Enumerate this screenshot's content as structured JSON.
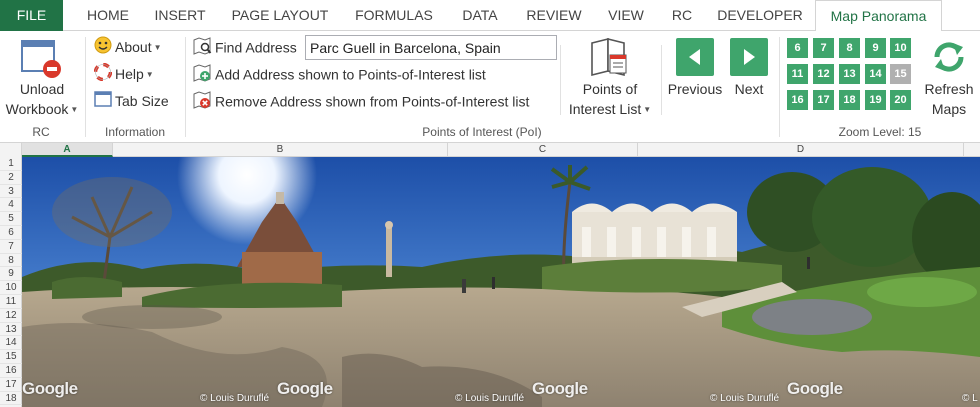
{
  "tabs": [
    {
      "label": "FILE"
    },
    {
      "label": "HOME"
    },
    {
      "label": "INSERT"
    },
    {
      "label": "PAGE LAYOUT"
    },
    {
      "label": "FORMULAS"
    },
    {
      "label": "DATA"
    },
    {
      "label": "REVIEW"
    },
    {
      "label": "VIEW"
    },
    {
      "label": "RC"
    },
    {
      "label": "DEVELOPER"
    },
    {
      "label": "Map Panorama"
    }
  ],
  "ribbon": {
    "rc": {
      "unload_line1": "Unload",
      "unload_line2": "Workbook",
      "group_label": "RC"
    },
    "information": {
      "about": "About",
      "help": "Help",
      "tab_size": "Tab Size",
      "group_label": "Information"
    },
    "poi": {
      "find_address_label": "Find Address",
      "address_value": "Parc Guell in Barcelona, Spain",
      "add_label": "Add Address shown to Points-of-Interest list",
      "remove_label": "Remove Address shown from Points-of-Interest list",
      "list_line1": "Points of",
      "list_line2": "Interest List",
      "previous": "Previous",
      "next": "Next",
      "group_label": "Points of Interest (PoI)"
    },
    "zoom": {
      "levels": [
        "6",
        "7",
        "8",
        "9",
        "10",
        "11",
        "12",
        "13",
        "14",
        "15",
        "16",
        "17",
        "18",
        "19",
        "20"
      ],
      "selected": "15",
      "refresh_line1": "Refresh",
      "refresh_line2": "Maps",
      "group_label": "Zoom Level: 15"
    }
  },
  "sheet": {
    "columns": [
      "A",
      "B",
      "C",
      "D"
    ],
    "rows": [
      "1",
      "2",
      "3",
      "4",
      "5",
      "6",
      "7",
      "8",
      "9",
      "10",
      "11",
      "12",
      "13",
      "14",
      "15",
      "16",
      "17",
      "18"
    ]
  },
  "panorama": {
    "watermark": "Google",
    "copyright": "© Louis Duruflé",
    "copyright_cut": "© L"
  },
  "colors": {
    "excel_green": "#217346",
    "button_green": "#3fa56c",
    "zoom_selected": "#b0b0b0"
  }
}
